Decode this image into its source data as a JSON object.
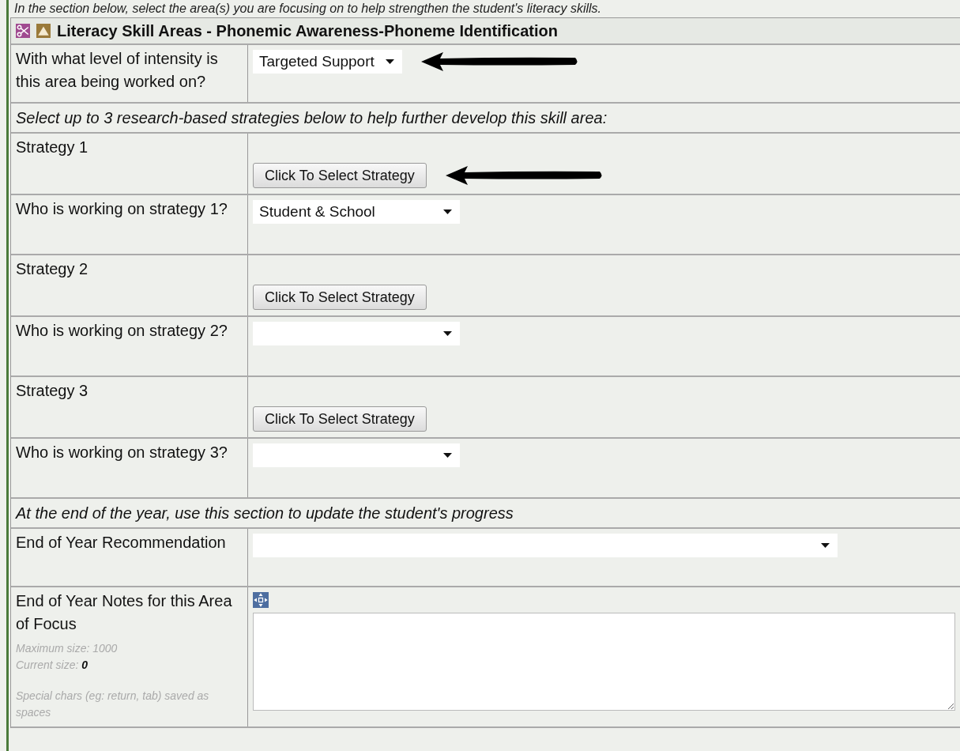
{
  "intro_text": "In the section below, select the area(s) you are focusing on to help strengthen the student's literacy skills.",
  "section": {
    "title": "Literacy Skill Areas - Phonemic Awareness-Phoneme Identification"
  },
  "rows": [
    {
      "kind": "compact-select",
      "label": "With what level of intensity is this area being worked on?",
      "value": "Targeted Support",
      "annotated": true
    },
    {
      "kind": "note",
      "text": "Select up to 3 research-based strategies below to help further develop this skill area:"
    },
    {
      "kind": "strategy",
      "label": "Strategy 1",
      "button": "Click To Select Strategy",
      "annotated": true
    },
    {
      "kind": "select",
      "label": "Who is working on strategy 1?",
      "value": "Student & School",
      "annotated": false
    },
    {
      "kind": "strategy",
      "label": "Strategy 2",
      "button": "Click To Select Strategy",
      "annotated": false
    },
    {
      "kind": "select",
      "label": "Who is working on strategy 2?",
      "annotated": false
    },
    {
      "kind": "strategy",
      "label": "Strategy 3",
      "button": "Click To Select Strategy",
      "annotated": false
    },
    {
      "kind": "select",
      "label": "Who is working on strategy 3?",
      "annotated": false
    },
    {
      "kind": "note",
      "text": "At the end of the year, use this section to update the student's progress"
    },
    {
      "kind": "wide-select",
      "label": "End of Year Recommendation",
      "annotated": false
    },
    {
      "kind": "textarea",
      "label": "End of Year Notes for this Area of Focus",
      "hints": [
        "Maximum size: 1000",
        "Current size: **0**"
      ],
      "footnote": "Special chars (eg: return, tab) saved as spaces"
    }
  ]
}
